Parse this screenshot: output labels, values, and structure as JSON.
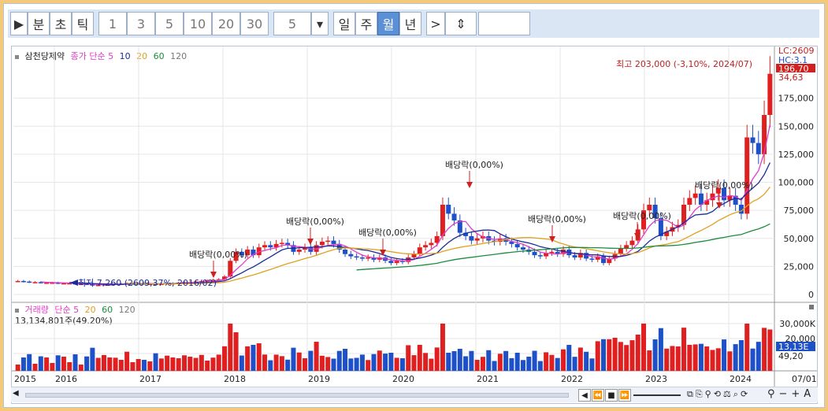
{
  "toolbar": {
    "buttons": [
      {
        "label": "▶"
      },
      {
        "label": "분"
      },
      {
        "label": "초"
      },
      {
        "label": "틱"
      },
      {
        "label": "1"
      },
      {
        "label": "3"
      },
      {
        "label": "5"
      },
      {
        "label": "10"
      },
      {
        "label": "20"
      },
      {
        "label": "30"
      },
      {
        "label": "5"
      },
      {
        "label": "▾"
      },
      {
        "label": "일"
      },
      {
        "label": "주"
      },
      {
        "label": "월"
      },
      {
        "label": "년"
      },
      {
        "label": ">"
      },
      {
        "label": "⇕"
      }
    ],
    "active": "월"
  },
  "price_legend": {
    "name": "삼천당제약",
    "ma_label": "종가 단순 5",
    "ma10": "10",
    "ma20": "20",
    "ma60": "60",
    "ma120": "120"
  },
  "volume_legend": {
    "name": "거래량",
    "ma_label": "단순 5",
    "ma20": "20",
    "ma60": "60",
    "ma120": "120",
    "value": "13,134,801주(49.20%)"
  },
  "price_axis": {
    "ticks": [
      "175,000",
      "150,000",
      "125,000",
      "100,000",
      "75,000",
      "50,000",
      "25,000",
      "0"
    ],
    "tags": {
      "lc": "LC:2609",
      "hc": "HC:3.1",
      "current": "196,70",
      "sub": "34,63"
    }
  },
  "volume_axis": {
    "ticks": [
      "30,000K",
      "20,000",
      "10,000"
    ],
    "tags": {
      "current": "13,13E",
      "pct": "49,20"
    }
  },
  "x_axis": {
    "labels": [
      "2015",
      "2016",
      "2017",
      "2018",
      "2019",
      "2020",
      "2021",
      "2022",
      "2023",
      "2024",
      "07/01"
    ]
  },
  "annotations": {
    "high": "최고 203,000 (-3,10%, 2024/07)",
    "low": "최저 7,260 (2609,37%, 2016/02)",
    "dividend": "배당락(0,00%)"
  },
  "colors": {
    "up": "#e02020",
    "down": "#1e50c8",
    "ma5": "#e03cc8",
    "ma10": "#1a2a9a",
    "ma20": "#e0a020",
    "ma60": "#1c8c3c",
    "grid": "#e6e6e6"
  },
  "chart_data": {
    "type": "candlestick",
    "title": "삼천당제약",
    "period": "monthly",
    "x_range": [
      "2015/01",
      "2024/07"
    ],
    "ylim": [
      0,
      210000
    ],
    "high": {
      "value": 203000,
      "date": "2024/07"
    },
    "low": {
      "value": 7260,
      "date": "2016/02"
    },
    "close_approx": [
      12000,
      11500,
      11000,
      11000,
      10500,
      10500,
      10500,
      10000,
      10000,
      10000,
      9500,
      9500,
      9000,
      8000,
      8500,
      9000,
      9000,
      9500,
      9500,
      10000,
      10000,
      10000,
      9500,
      9500,
      9000,
      9500,
      10000,
      10000,
      10500,
      11000,
      11000,
      11500,
      12000,
      12500,
      13000,
      13500,
      16000,
      30000,
      38000,
      35000,
      40000,
      35000,
      42000,
      44000,
      42000,
      45000,
      46000,
      44000,
      38000,
      40000,
      42000,
      38000,
      44000,
      47000,
      48000,
      45000,
      40000,
      36000,
      34000,
      33000,
      32000,
      33000,
      31000,
      33000,
      30000,
      28000,
      30000,
      29000,
      33000,
      36000,
      42000,
      44000,
      46000,
      52000,
      80000,
      72000,
      66000,
      55000,
      52000,
      48000,
      50000,
      52000,
      48000,
      47000,
      50000,
      47000,
      45000,
      42000,
      40000,
      38000,
      35000,
      34000,
      37000,
      38000,
      36000,
      40000,
      35000,
      33000,
      37000,
      32000,
      31000,
      34000,
      28000,
      32000,
      36000,
      41000,
      44000,
      48000,
      58000,
      75000,
      80000,
      68000,
      52000,
      56000,
      60000,
      62000,
      80000,
      86000,
      90000,
      80000,
      84000,
      90000,
      95000,
      84000,
      88000,
      80000,
      72000,
      140000,
      135000,
      125000,
      160000,
      196700
    ],
    "volume_ma": {
      "5": "pink",
      "20": "orange",
      "60": "green",
      "120": "gray"
    }
  }
}
